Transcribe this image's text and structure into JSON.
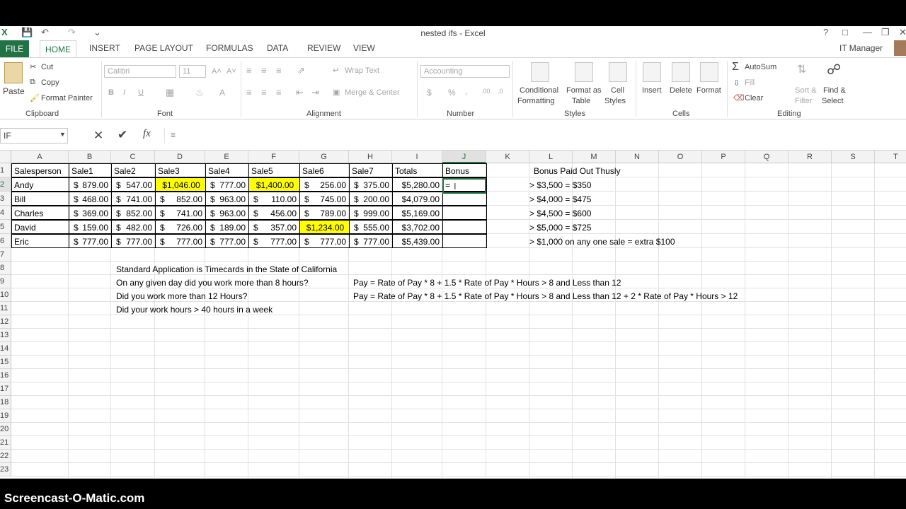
{
  "window": {
    "title": "nested ifs - Excel",
    "user": "IT Manager"
  },
  "tabs": [
    "FILE",
    "HOME",
    "INSERT",
    "PAGE LAYOUT",
    "FORMULAS",
    "DATA",
    "REVIEW",
    "VIEW"
  ],
  "ribbon": {
    "clipboard": {
      "paste": "Paste",
      "cut": "Cut",
      "copy": "Copy",
      "format_painter": "Format Painter",
      "group": "Clipboard"
    },
    "font": {
      "name": "Calibri",
      "size": "11",
      "bold": "B",
      "italic": "I",
      "underline": "U",
      "group": "Font"
    },
    "alignment": {
      "wrap": "Wrap Text",
      "merge": "Merge & Center",
      "group": "Alignment"
    },
    "number": {
      "format": "Accounting",
      "dollar": "$",
      "percent": "%",
      "comma": ",",
      "group": "Number"
    },
    "styles": {
      "conditional_1": "Conditional",
      "conditional_2": "Formatting",
      "format_as_1": "Format as",
      "format_as_2": "Table",
      "cell_styles_1": "Cell",
      "cell_styles_2": "Styles",
      "group": "Styles"
    },
    "cells": {
      "insert": "Insert",
      "delete": "Delete",
      "format": "Format",
      "group": "Cells"
    },
    "editing": {
      "autosum": "AutoSum",
      "fill": "Fill",
      "clear": "Clear",
      "sort_1": "Sort &",
      "sort_2": "Filter",
      "find_1": "Find &",
      "find_2": "Select",
      "group": "Editing"
    }
  },
  "formula_bar": {
    "name_box": "IF",
    "formula": "="
  },
  "columns": [
    "A",
    "B",
    "C",
    "D",
    "E",
    "F",
    "G",
    "H",
    "I",
    "J",
    "K",
    "L",
    "M",
    "N",
    "O",
    "P",
    "Q",
    "R",
    "S",
    "T"
  ],
  "rows": [
    "1",
    "2",
    "3",
    "4",
    "5",
    "6",
    "7",
    "8",
    "9",
    "10",
    "11",
    "12",
    "13",
    "14",
    "15",
    "16",
    "17",
    "18",
    "19",
    "20",
    "21",
    "22",
    "23"
  ],
  "table": {
    "headers": [
      "Salesperson",
      "Sale1",
      "Sale2",
      "Sale3",
      "Sale4",
      "Sale5",
      "Sale6",
      "Sale7",
      "Totals",
      "Bonus"
    ],
    "rows": [
      {
        "name": "Andy",
        "sales": [
          "879.00",
          "547.00",
          "1,046.00",
          "777.00",
          "1,400.00",
          "256.00",
          "375.00"
        ],
        "total": "$5,280.00",
        "bonus": "="
      },
      {
        "name": "Bill",
        "sales": [
          "468.00",
          "741.00",
          "852.00",
          "963.00",
          "110.00",
          "745.00",
          "200.00"
        ],
        "total": "$4,079.00",
        "bonus": ""
      },
      {
        "name": "Charles",
        "sales": [
          "369.00",
          "852.00",
          "741.00",
          "963.00",
          "456.00",
          "789.00",
          "999.00"
        ],
        "total": "$5,169.00",
        "bonus": ""
      },
      {
        "name": "David",
        "sales": [
          "159.00",
          "482.00",
          "726.00",
          "189.00",
          "357.00",
          "1,234.00",
          "555.00"
        ],
        "total": "$3,702.00",
        "bonus": ""
      },
      {
        "name": "Eric",
        "sales": [
          "777.00",
          "777.00",
          "777.00",
          "777.00",
          "777.00",
          "777.00",
          "777.00"
        ],
        "total": "$5,439.00",
        "bonus": ""
      }
    ],
    "highlighted": [
      [
        0,
        2
      ],
      [
        0,
        4
      ],
      [
        3,
        5
      ]
    ],
    "highlight_color": "#ffff00"
  },
  "bonus_rules": {
    "title": "Bonus Paid Out Thusly",
    "items": [
      "> $3,500 = $350",
      "> $4,000 = $475",
      "> $4,500 = $600",
      "> $5,000 = $725",
      "> $1,000 on any one sale = extra $100"
    ]
  },
  "notes": {
    "line8": "Standard Application is Timecards in the State of California",
    "line9": "On any given day did you work more than 8 hours?",
    "line9_formula": "Pay = Rate of Pay * 8 + 1.5 * Rate of Pay * Hours > 8 and Less than 12",
    "line10": "Did you work more than 12 Hours?",
    "line10_formula": "Pay = Rate of Pay * 8 + 1.5 * Rate of Pay * Hours > 8 and Less than 12 + 2 * Rate of Pay * Hours > 12",
    "line11": "Did your work hours > 40 hours in a week"
  },
  "watermark": "Screencast-O-Matic.com",
  "colors": {
    "excel_green": "#217346",
    "highlight": "#ffff00"
  }
}
